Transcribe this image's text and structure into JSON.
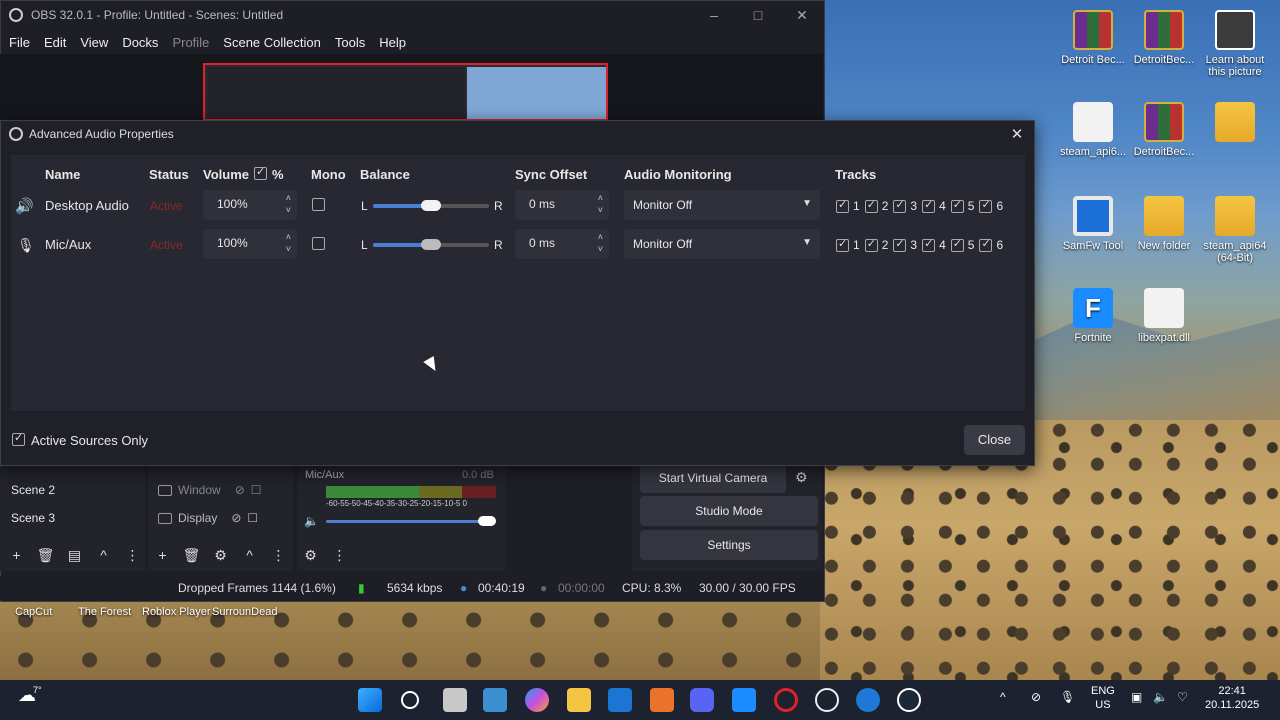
{
  "obs": {
    "title": "OBS 32.0.1 - Profile: Untitled - Scenes: Untitled",
    "menu": [
      "File",
      "Edit",
      "View",
      "Docks",
      "Profile",
      "Scene Collection",
      "Tools",
      "Help"
    ],
    "scenes": [
      "Scene 2",
      "Scene 3"
    ],
    "sources": [
      "Window",
      "Display"
    ],
    "mixer": {
      "label": "Mic/Aux",
      "db": "0.0 dB",
      "scale": "-60-55-50-45-40-35-30-25-20-15-10-5  0"
    },
    "controls": [
      "Start Virtual Camera",
      "Studio Mode",
      "Settings"
    ],
    "status": {
      "dropped": "Dropped Frames 1144 (1.6%)",
      "kbps": "5634 kbps",
      "rec_time": "00:40:19",
      "stream_time": "00:00:00",
      "cpu": "CPU: 8.3%",
      "fps": "30.00 / 30.00 FPS"
    }
  },
  "dialog": {
    "title": "Advanced Audio Properties",
    "headers": {
      "name": "Name",
      "status": "Status",
      "volume": "Volume",
      "percent": "%",
      "mono": "Mono",
      "balance": "Balance",
      "sync": "Sync Offset",
      "monitoring": "Audio Monitoring",
      "tracks": "Tracks"
    },
    "rows": [
      {
        "name": "Desktop Audio",
        "status": "Active",
        "volume": "100%",
        "mono": false,
        "balance_l": "L",
        "balance_r": "R",
        "balance_value": 0.5,
        "sync": "0 ms",
        "monitoring": "Monitor Off",
        "tracks": [
          "1",
          "2",
          "3",
          "4",
          "5",
          "6"
        ]
      },
      {
        "name": "Mic/Aux",
        "status": "Active",
        "volume": "100%",
        "mono": false,
        "balance_l": "L",
        "balance_r": "R",
        "balance_value": 0.5,
        "sync": "0 ms",
        "monitoring": "Monitor Off",
        "tracks": [
          "1",
          "2",
          "3",
          "4",
          "5",
          "6"
        ]
      }
    ],
    "active_only_label": "Active Sources Only",
    "close_label": "Close"
  },
  "desktop": {
    "icons": [
      "Detroit Bec...",
      "DetroitBec...",
      "Learn about this picture",
      "steam_api6...",
      "DetroitBec...",
      "SamFw Tool",
      "New folder",
      "steam_api64 (64-Bit)",
      "Fortnite",
      "libexpat.dll"
    ],
    "taskbar_labels": [
      "CapCut",
      "The Forest",
      "Roblox Player",
      "SurrounDead"
    ]
  },
  "taskbar": {
    "weather": "7°",
    "lang": "ENG",
    "region": "US",
    "time": "22:41",
    "date": "20.11.2025"
  }
}
